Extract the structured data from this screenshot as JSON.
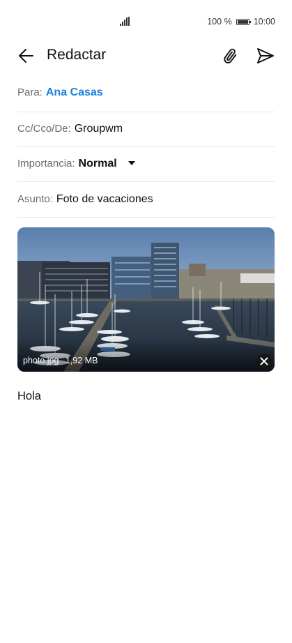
{
  "status_bar": {
    "battery_percent": "100 %",
    "time": "10:00"
  },
  "app_bar": {
    "title": "Redactar"
  },
  "fields": {
    "to": {
      "label": "Para:",
      "value": "Ana Casas"
    },
    "cc": {
      "label": "Cc/Cco/De:",
      "value": "Groupwm"
    },
    "importance": {
      "label": "Importancia:",
      "value": "Normal"
    },
    "subject": {
      "label": "Asunto:",
      "value": "Foto de vacaciones"
    }
  },
  "attachment": {
    "filename": "photo.jpg",
    "size": "1,92 MB"
  },
  "body": {
    "text": "Hola"
  },
  "colors": {
    "accent": "#1a7fe0",
    "divider": "#e6e6e6"
  }
}
